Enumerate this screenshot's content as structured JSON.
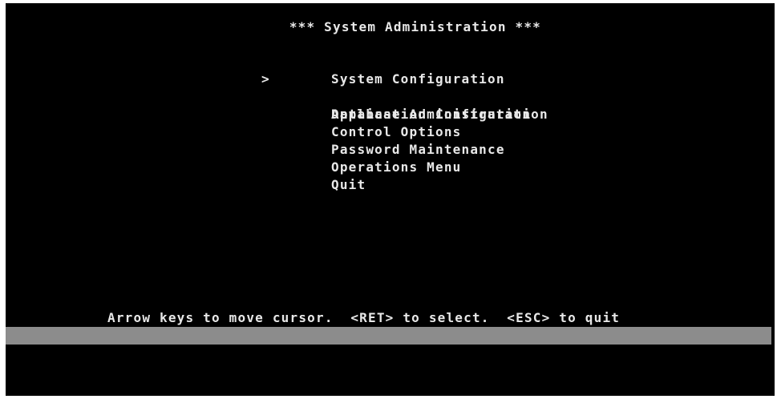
{
  "header": {
    "title": "*** System Administration ***"
  },
  "menu": {
    "cursor": ">",
    "selected_index": 1,
    "items": [
      {
        "label": "System Configuration"
      },
      {
        "label": "Application Configuration"
      },
      {
        "label": "Database Administration"
      },
      {
        "label": "Control Options"
      },
      {
        "label": "Password Maintenance"
      },
      {
        "label": "Operations Menu"
      },
      {
        "label": "Quit"
      }
    ]
  },
  "footer": {
    "hint": "Arrow keys to move cursor.  <RET> to select.  <ESC> to quit"
  },
  "colors": {
    "background": "#000000",
    "text": "#e8e8e8",
    "status_bar": "#8c8c8c"
  }
}
